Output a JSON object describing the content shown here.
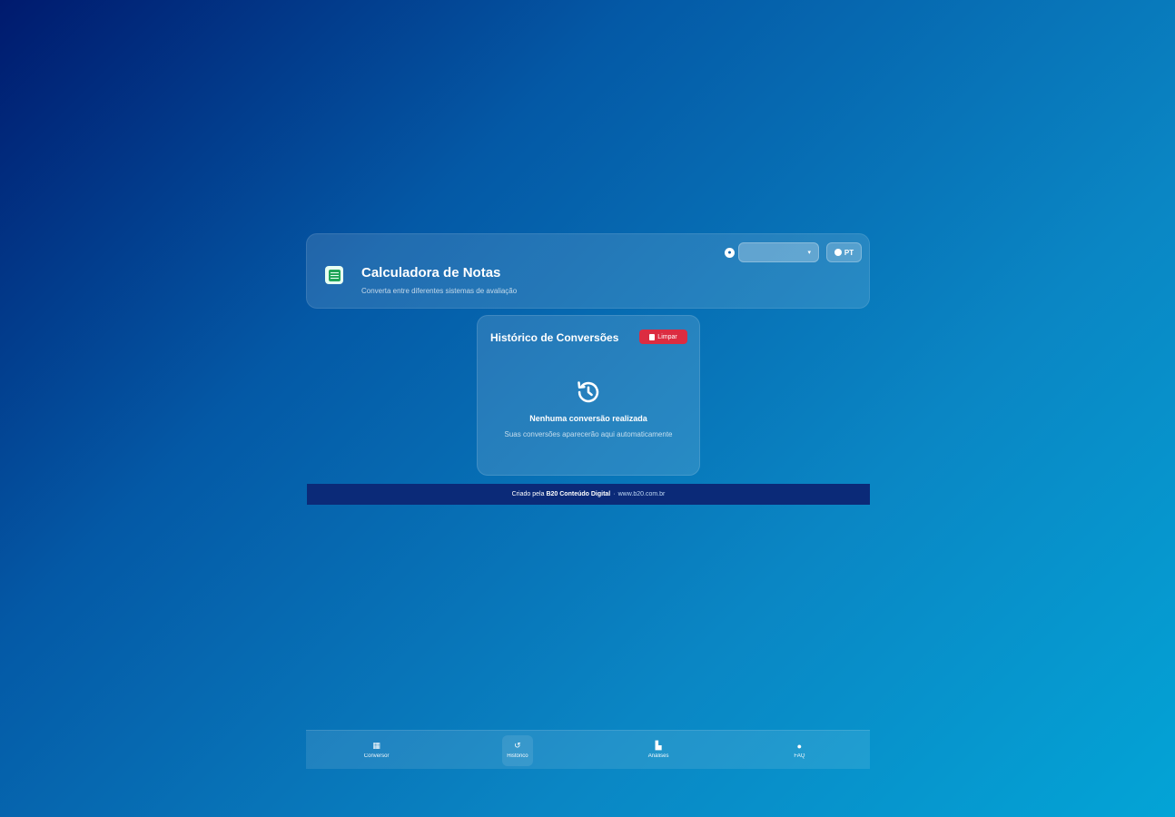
{
  "header": {
    "title": "Calculadora de Notas",
    "subtitle": "Converta entre diferentes sistemas de avaliação",
    "theme_select_value": "",
    "lang_label": "PT"
  },
  "history": {
    "title": "Histórico de Conversões",
    "clear_label": "Limpar",
    "empty_title": "Nenhuma conversão realizada",
    "empty_subtitle": "Suas conversões aparecerão aqui automaticamente"
  },
  "footer": {
    "prefix": "Criado pela",
    "brand": "B20 Conteúdo Digital",
    "separator": "·",
    "site": "www.b20.com.br"
  },
  "nav": {
    "items": [
      {
        "label": "Conversor",
        "icon": "calculator-icon"
      },
      {
        "label": "Histórico",
        "icon": "history-icon"
      },
      {
        "label": "Análises",
        "icon": "chart-icon"
      },
      {
        "label": "FAQ",
        "icon": "help-icon"
      }
    ]
  },
  "colors": {
    "clear_button": "#dc2c41",
    "footer_bar": "#0b2a78"
  }
}
